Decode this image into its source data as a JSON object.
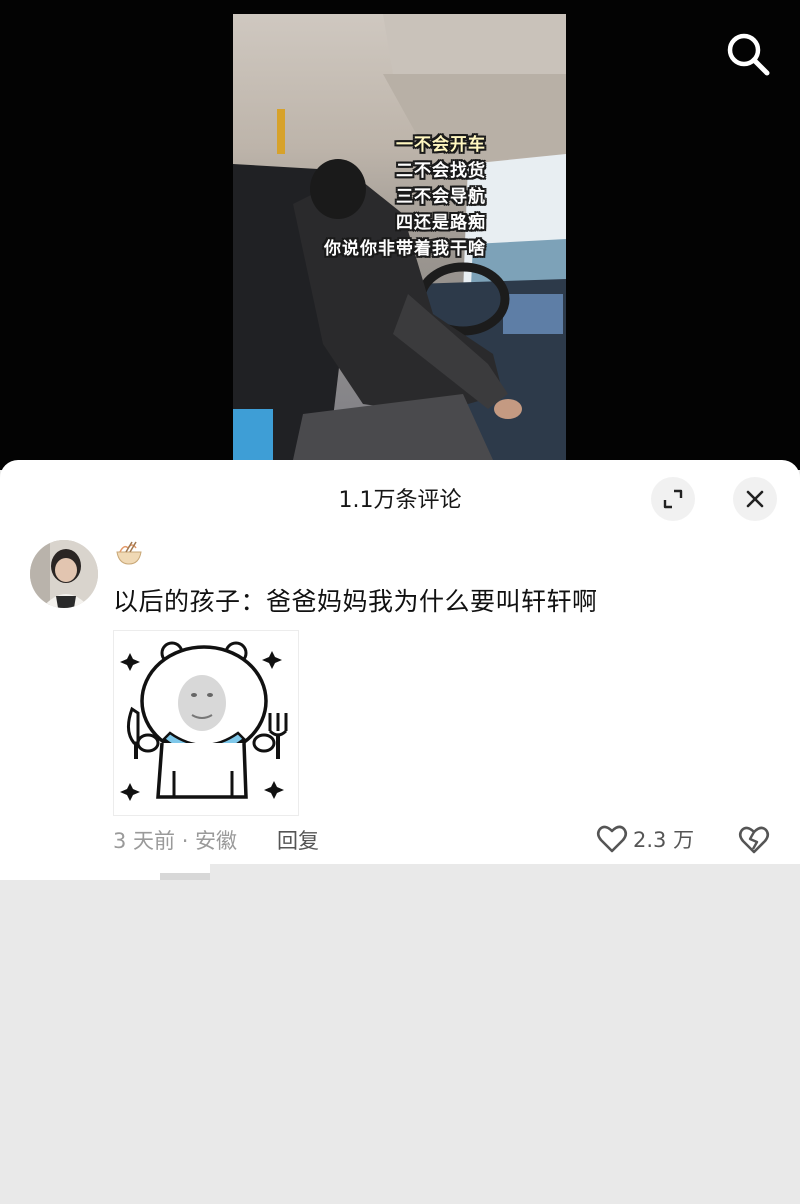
{
  "video": {
    "overlay_lines": [
      "一不会开车",
      "二不会找货",
      "三不会导航",
      "四还是路痴",
      "你说你非带着我干啥"
    ]
  },
  "icons": {
    "search": "search-icon",
    "expand": "expand-icon",
    "close": "close-icon",
    "badge": "noodle-bowl-icon",
    "like": "heart-icon",
    "dislike": "broken-heart-icon"
  },
  "comments_panel": {
    "title": "1.1万条评论"
  },
  "comment": {
    "text": "以后的孩子：爸爸妈妈我为什么要叫轩轩啊",
    "meta": "3 天前 · 安徽",
    "reply_label": "回复",
    "likes": "2.3 万"
  },
  "colors": {
    "background": "#e9e9e9",
    "video_bg": "#030303",
    "sheet": "#ffffff",
    "meta_text": "#9a9a9a"
  }
}
